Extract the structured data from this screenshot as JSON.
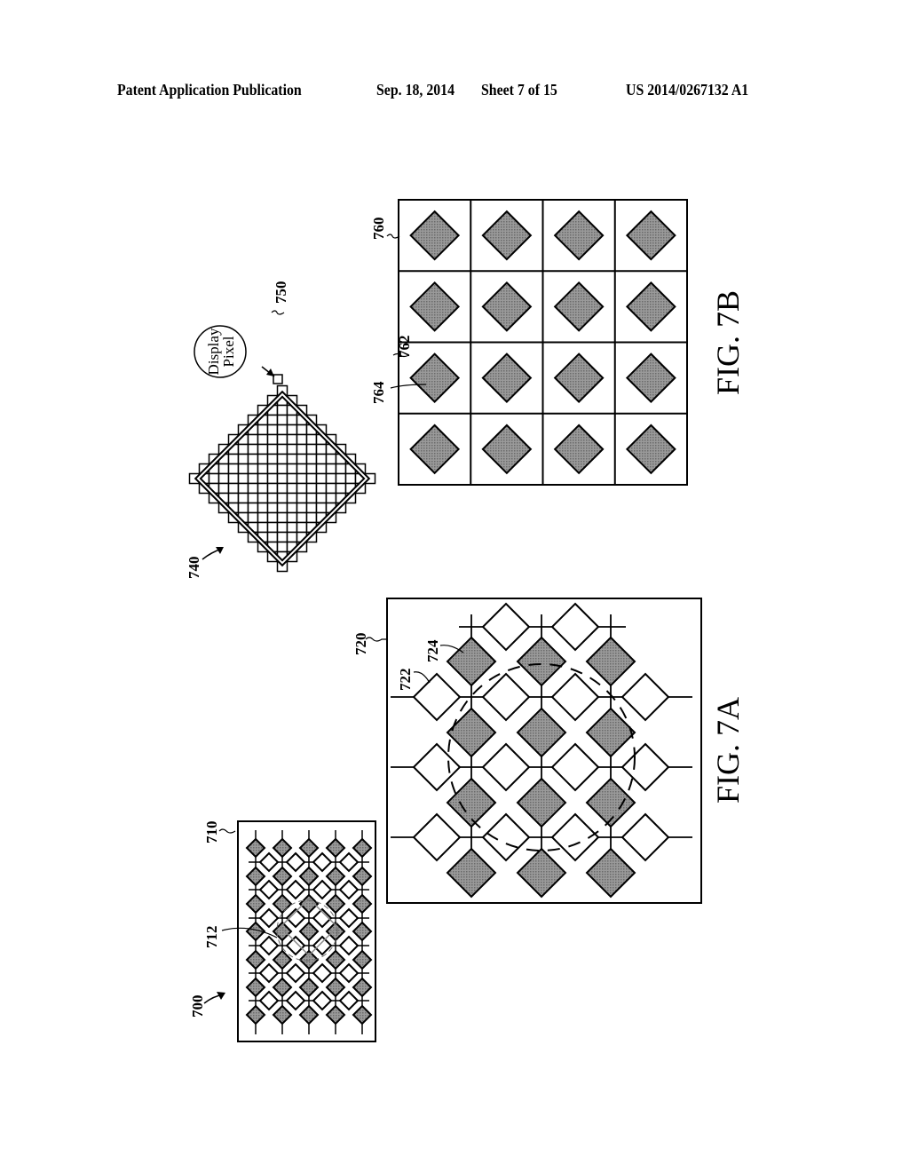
{
  "header": {
    "publication": "Patent Application Publication",
    "date": "Sep. 18, 2014",
    "sheet": "Sheet 7 of 15",
    "number": "US 2014/0267132 A1"
  },
  "figures": {
    "fig7a": {
      "caption": "FIG. 7A",
      "labels": {
        "overall": "700",
        "panel_small": "710",
        "region": "712",
        "panel_large": "720",
        "white_diamond": "722",
        "gray_diamond": "724"
      }
    },
    "fig7b": {
      "caption": "FIG. 7B",
      "labels": {
        "pixel_diamond": "740",
        "display_pixel": "750",
        "grid": "760",
        "cell": "762",
        "diamond": "764"
      },
      "callout_line1": "Display",
      "callout_line2": "Pixel",
      "grid_rows": 4,
      "grid_cols": 4
    }
  },
  "colors": {
    "ink": "#000000",
    "gray_fill": "#8a8a8a",
    "paper": "#ffffff"
  }
}
